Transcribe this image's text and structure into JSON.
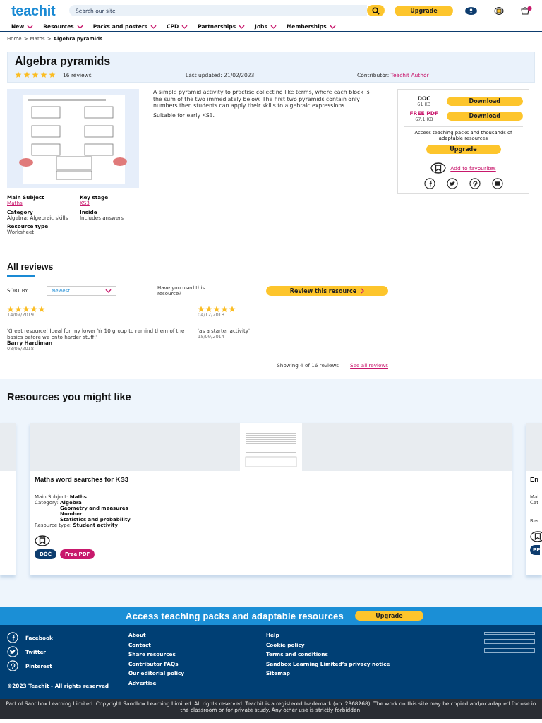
{
  "header": {
    "logo": "teachit",
    "search": {
      "placeholder": "Search our site"
    },
    "upgrade": "Upgrade"
  },
  "nav": [
    {
      "label": "New"
    },
    {
      "label": "Resources"
    },
    {
      "label": "Packs and posters"
    },
    {
      "label": "CPD"
    },
    {
      "label": "Partnerships"
    },
    {
      "label": "Jobs"
    },
    {
      "label": "Memberships"
    }
  ],
  "breadcrumb": {
    "separator": ">",
    "items": [
      "Home",
      "Maths",
      "Algebra pyramids"
    ]
  },
  "resource": {
    "title": "Algebra pyramids",
    "stars": 5,
    "reviews_link": "16 reviews",
    "last_updated": "Last updated: 21/02/2023",
    "contributor_label": "Contributor:",
    "contributor": "Teachit Author",
    "preview": {
      "kind": "picture"
    },
    "meta": [
      {
        "label": "Main Subject",
        "value": "Maths",
        "link": true
      },
      {
        "label": "Key stage",
        "value": "KS3",
        "link": true
      },
      {
        "label": "Category",
        "value": "Algebra: Algebraic skills",
        "link": false
      },
      {
        "label": "Inside",
        "value": "Includes answers",
        "link": false
      },
      {
        "label": "Resource type",
        "value": "Worksheet",
        "link": false
      }
    ],
    "description": [
      "A simple pyramid activity to practise collecting like terms, where each block is the sum of the two immediately below. The first two pyramids contain only numbers then students can apply their skills to algebraic expressions.",
      "Suitable for early KS3."
    ],
    "downloads": [
      {
        "format": "DOC",
        "size": "61 KB",
        "button": "Download",
        "free": false
      },
      {
        "format": "FREE PDF",
        "size": "67.1 KB",
        "button": "Download",
        "free": true
      }
    ],
    "upsell": "Access teaching packs and thousands of adaptable resources",
    "upgrade": "Upgrade",
    "favourites": "Add to favourites"
  },
  "reviews": {
    "heading": "All reviews",
    "sort_label": "SORT BY",
    "sort_value": "Newest",
    "prompt": "Have you used this resource?",
    "review_button": "Review this resource",
    "items": [
      {
        "stars": 5,
        "date": "14/09/2019"
      },
      {
        "stars": 5,
        "date": "04/12/2018"
      },
      {
        "text": "'Great resource! Ideal for my lower Yr 10 group to remind them of the basics before we onto harder stuff!'",
        "author": "Barry Hardiman",
        "date": "08/05/2018"
      },
      {
        "text": "'as a starter activity'",
        "date": "15/09/2014"
      }
    ],
    "showing": "Showing 4 of 16 reviews",
    "see_all": "See all reviews"
  },
  "related": {
    "heading": "Resources you might like",
    "card": {
      "title": "Maths word searches for KS3",
      "thumbnail": {
        "kind": "picture"
      },
      "subject_label": "Main Subject:",
      "subject": "Maths",
      "category_label": "Category:",
      "categories": [
        "Algebra",
        "Geometry and measures",
        "Number",
        "Statistics and probability"
      ],
      "type_label": "Resource type:",
      "type": "Student activity",
      "badges": [
        {
          "label": "DOC",
          "color": "#0d3c6e"
        },
        {
          "label": "Free PDF",
          "color": "#c8186c"
        }
      ]
    },
    "next_card": {
      "title": "En",
      "labels": [
        "Mai",
        "Cat",
        "Res"
      ],
      "badges": [
        {
          "label": "PP",
          "color": "#0d3c6e"
        }
      ]
    }
  },
  "footer": {
    "banner": "Access teaching packs and adaptable resources",
    "upgrade": "Upgrade",
    "social": [
      {
        "kind": "facebook",
        "label": "Facebook"
      },
      {
        "kind": "twitter",
        "label": "Twitter"
      },
      {
        "kind": "pinterest",
        "label": "Pinterest"
      }
    ],
    "copyright": "©2023 Teachit - All rights reserved",
    "links_1": [
      "About",
      "Contact",
      "Share resources",
      "Contributor FAQs",
      "Our editorial policy",
      "Advertise"
    ],
    "links_2": [
      "Help",
      "Cookie policy",
      "Terms and conditions",
      "Sandbox Learning Limited’s privacy notice",
      "Sitemap"
    ],
    "legal": "Part of Sandbox Learning Limited. Copyright Sandbox Learning Limited. All rights reserved. Teachit is a registered trademark (no. 2368268). The work on this site may be copied and/or adapted for use in the classroom or for private study. Any other use is strictly forbidden."
  }
}
